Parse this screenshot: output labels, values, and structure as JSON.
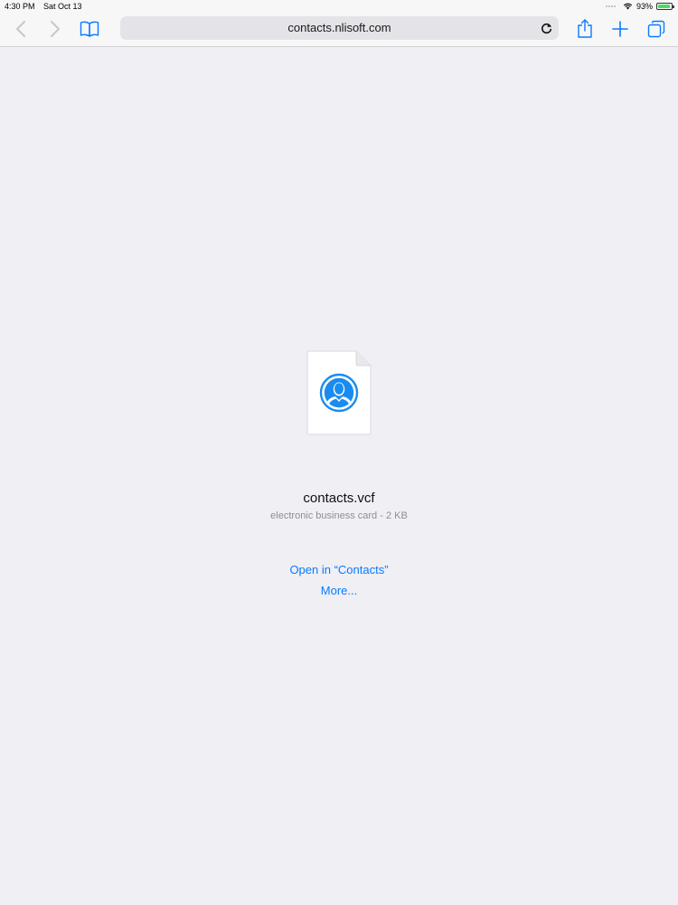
{
  "status_bar": {
    "time": "4:30 PM",
    "date": "Sat Oct 13",
    "battery": "93%",
    "battery_level": 0.93
  },
  "toolbar": {
    "url": "contacts.nlisoft.com",
    "icons": {
      "back": "back-chevron-icon",
      "forward": "forward-chevron-icon",
      "bookmarks": "bookmarks-book-icon",
      "reload": "reload-icon",
      "share": "share-icon",
      "new_tab": "plus-icon",
      "tabs": "tabs-overview-icon"
    }
  },
  "file": {
    "name": "contacts.vcf",
    "meta": "electronic business card - 2 KB",
    "icon": "contact-person-icon"
  },
  "actions": {
    "open_in": "Open in “Contacts”",
    "more": "More..."
  },
  "colors": {
    "background": "#efeff4",
    "accent": "#0a7aff",
    "toolbar_bg": "#f7f7f7"
  }
}
